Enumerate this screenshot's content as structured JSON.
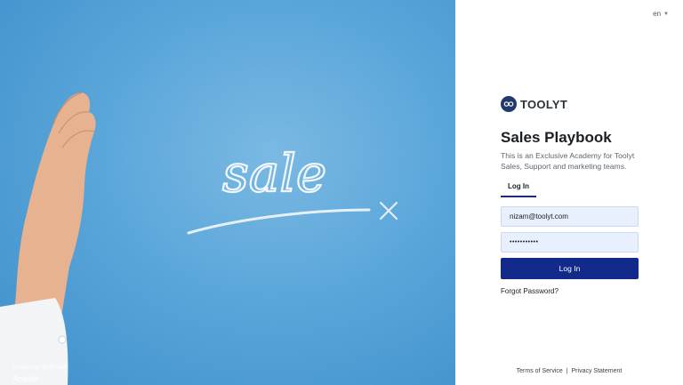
{
  "hero": {
    "chalk_word": "sale",
    "built_with": "Academy built with",
    "built_brand": "Acadle"
  },
  "header": {
    "language": "en"
  },
  "brand": {
    "name": "TOOLYT"
  },
  "login": {
    "title": "Sales Playbook",
    "subtitle": "This is an Exclusive Academy for Toolyt Sales, Support and marketing teams.",
    "tab_label": "Log In",
    "email_value": "nizam@toolyt.com",
    "password_value": "•••••••••••",
    "button_label": "Log In",
    "forgot_label": "Forgot Password?"
  },
  "footer": {
    "terms": "Terms of Service",
    "separator": "|",
    "privacy": "Privacy Statement"
  },
  "colors": {
    "primary_button": "#122a8a",
    "input_bg": "#e8f0fe",
    "hero_blue": "#5aa6da"
  }
}
